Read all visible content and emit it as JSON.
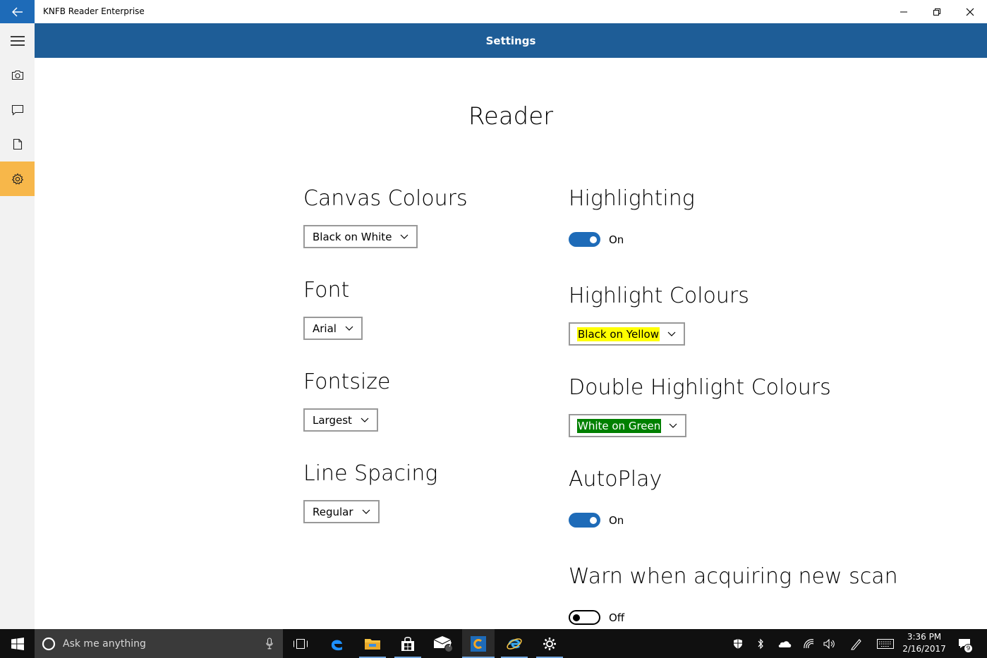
{
  "window": {
    "title": "KNFB Reader Enterprise"
  },
  "header": {
    "title": "Settings"
  },
  "rail": {
    "items": [
      {
        "name": "menu",
        "icon": "hamburger-icon"
      },
      {
        "name": "camera",
        "icon": "camera-icon"
      },
      {
        "name": "messages",
        "icon": "chat-icon"
      },
      {
        "name": "documents",
        "icon": "document-icon"
      },
      {
        "name": "settings",
        "icon": "gear-icon",
        "active": true
      }
    ],
    "active_color": "#f7b74a"
  },
  "main": {
    "heading": "Reader",
    "left": {
      "canvas_colours": {
        "label": "Canvas Colours",
        "value": "Black on White"
      },
      "font": {
        "label": "Font",
        "value": "Arial"
      },
      "fontsize": {
        "label": "Fontsize",
        "value": "Largest"
      },
      "line_spacing": {
        "label": "Line Spacing",
        "value": "Regular"
      }
    },
    "right": {
      "highlighting": {
        "label": "Highlighting",
        "state": "On",
        "on": true
      },
      "highlight_colours": {
        "label": "Highlight Colours",
        "value": "Black on Yellow"
      },
      "double_highlight_colours": {
        "label": "Double Highlight Colours",
        "value": "White on Green"
      },
      "autoplay": {
        "label": "AutoPlay",
        "state": "On",
        "on": true
      },
      "warn_new_scan": {
        "label": "Warn when acquiring new scan",
        "state": "Off",
        "on": false
      }
    }
  },
  "taskbar": {
    "search_placeholder": "Ask me anything",
    "mail_badge": "7",
    "notification_badge": "9",
    "time": "3:36 PM",
    "date": "2/16/2017"
  },
  "colors": {
    "accent": "#1e6bb8",
    "header": "#1e5d97",
    "taskbar": "#101010"
  }
}
